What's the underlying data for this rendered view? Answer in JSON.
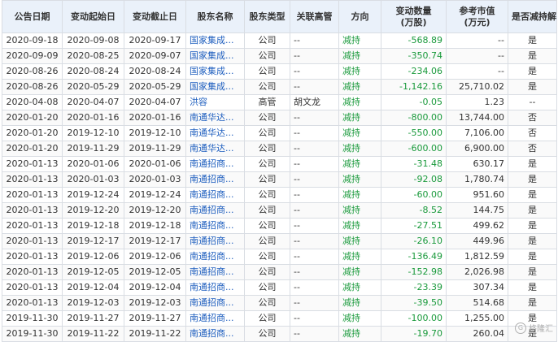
{
  "headers": [
    "公告日期",
    "变动起始日",
    "变动截止日",
    "股东名称",
    "股东类型",
    "关联高管",
    "方向",
    "变动数量\n(万股)",
    "参考市值\n(万元)",
    "是否减持解禁"
  ],
  "rows": [
    [
      "2020-09-18",
      "2020-09-08",
      "2020-09-17",
      "国家集成...",
      "公司",
      "--",
      "减持",
      "-568.89",
      "--",
      "是"
    ],
    [
      "2020-09-09",
      "2020-08-25",
      "2020-09-07",
      "国家集成...",
      "公司",
      "--",
      "减持",
      "-350.74",
      "--",
      "是"
    ],
    [
      "2020-08-26",
      "2020-08-24",
      "2020-08-24",
      "国家集成...",
      "公司",
      "--",
      "减持",
      "-234.06",
      "--",
      "是"
    ],
    [
      "2020-08-26",
      "2020-05-29",
      "2020-05-29",
      "国家集成...",
      "公司",
      "--",
      "减持",
      "-1,142.16",
      "25,710.02",
      "是"
    ],
    [
      "2020-04-08",
      "2020-04-07",
      "2020-04-07",
      "洪容",
      "高管",
      "胡文龙",
      "减持",
      "-0.05",
      "1.23",
      "--"
    ],
    [
      "2020-01-20",
      "2020-01-16",
      "2020-01-16",
      "南通华达...",
      "公司",
      "--",
      "减持",
      "-800.00",
      "13,744.00",
      "否"
    ],
    [
      "2020-01-20",
      "2019-12-10",
      "2019-12-10",
      "南通华达...",
      "公司",
      "--",
      "减持",
      "-550.00",
      "7,106.00",
      "否"
    ],
    [
      "2020-01-20",
      "2019-11-29",
      "2019-11-29",
      "南通华达...",
      "公司",
      "--",
      "减持",
      "-600.00",
      "6,900.00",
      "否"
    ],
    [
      "2020-01-13",
      "2020-01-06",
      "2020-01-06",
      "南通招商...",
      "公司",
      "--",
      "减持",
      "-31.48",
      "630.17",
      "是"
    ],
    [
      "2020-01-13",
      "2020-01-03",
      "2020-01-03",
      "南通招商...",
      "公司",
      "--",
      "减持",
      "-92.08",
      "1,780.74",
      "是"
    ],
    [
      "2020-01-13",
      "2019-12-24",
      "2019-12-24",
      "南通招商...",
      "公司",
      "--",
      "减持",
      "-60.00",
      "951.60",
      "是"
    ],
    [
      "2020-01-13",
      "2019-12-20",
      "2019-12-20",
      "南通招商...",
      "公司",
      "--",
      "减持",
      "-8.52",
      "144.75",
      "是"
    ],
    [
      "2020-01-13",
      "2019-12-18",
      "2019-12-18",
      "南通招商...",
      "公司",
      "--",
      "减持",
      "-27.51",
      "499.62",
      "是"
    ],
    [
      "2020-01-13",
      "2019-12-17",
      "2019-12-17",
      "南通招商...",
      "公司",
      "--",
      "减持",
      "-26.10",
      "449.96",
      "是"
    ],
    [
      "2020-01-13",
      "2019-12-06",
      "2019-12-06",
      "南通招商...",
      "公司",
      "--",
      "减持",
      "-136.49",
      "1,812.59",
      "是"
    ],
    [
      "2020-01-13",
      "2019-12-05",
      "2019-12-05",
      "南通招商...",
      "公司",
      "--",
      "减持",
      "-152.98",
      "2,026.98",
      "是"
    ],
    [
      "2020-01-13",
      "2019-12-04",
      "2019-12-04",
      "南通招商...",
      "公司",
      "--",
      "减持",
      "-23.39",
      "307.34",
      "是"
    ],
    [
      "2020-01-13",
      "2019-12-03",
      "2019-12-03",
      "南通招商...",
      "公司",
      "--",
      "减持",
      "-39.50",
      "514.68",
      "是"
    ],
    [
      "2019-11-30",
      "2019-11-27",
      "2019-11-27",
      "南通招商...",
      "公司",
      "--",
      "减持",
      "-100.00",
      "1,255.00",
      "是"
    ],
    [
      "2019-11-30",
      "2019-11-22",
      "2019-11-22",
      "南通招商...",
      "公司",
      "--",
      "减持",
      "-19.70",
      "260.04",
      "是"
    ]
  ],
  "watermark": {
    "icon": "G",
    "text": "格隆汇"
  },
  "colors": {
    "header_bg": "#eaf1fa",
    "name_link": "#1f5fbf",
    "reduce_green": "#1a9a3c",
    "border": "#d9dde3"
  }
}
